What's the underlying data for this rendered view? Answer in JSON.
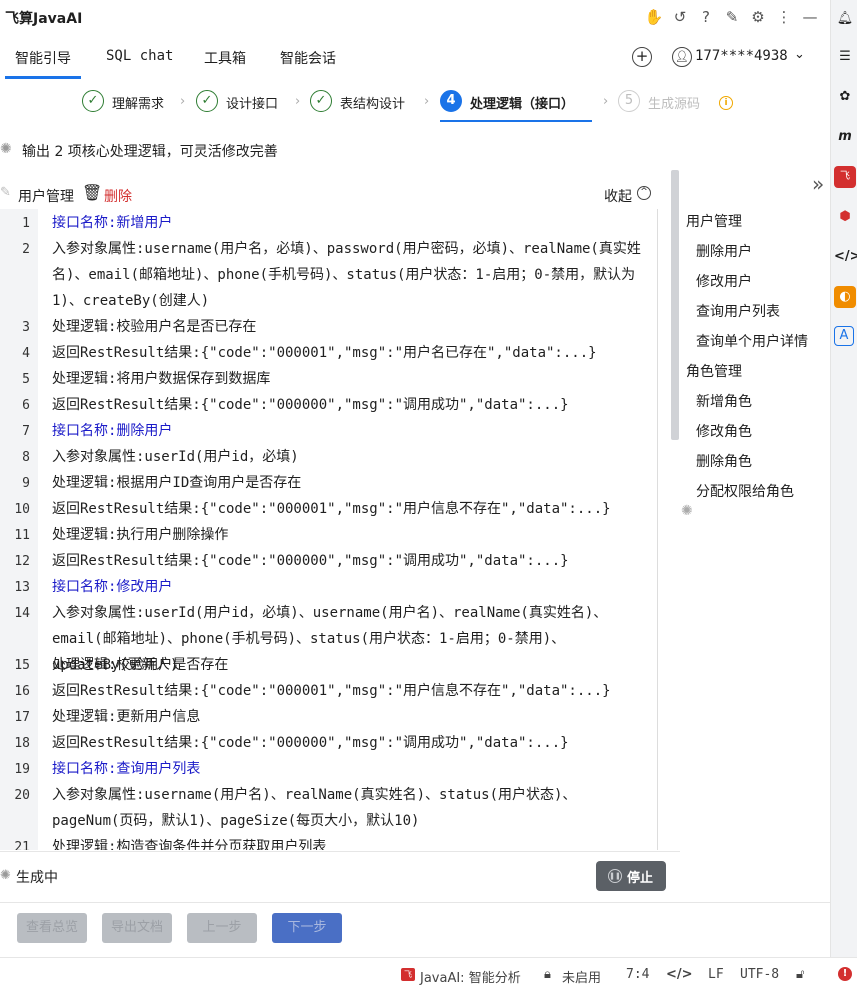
{
  "app": {
    "title": "飞算JavaAI"
  },
  "tabs": [
    "智能引导",
    "SQL chat",
    "工具箱",
    "智能会话"
  ],
  "user": {
    "phone": "177****4938"
  },
  "steps": [
    {
      "label": "理解需求",
      "state": "done"
    },
    {
      "label": "设计接口",
      "state": "done"
    },
    {
      "label": "表结构设计",
      "state": "done"
    },
    {
      "num": "4",
      "label": "处理逻辑（接口）",
      "state": "active"
    },
    {
      "num": "5",
      "label": "生成源码",
      "state": "pending"
    }
  ],
  "summary": "输出 2 项核心处理逻辑，可灵活修改完善",
  "section": {
    "name": "用户管理",
    "delete_label": "删除",
    "collapse_label": "收起"
  },
  "code_lines": [
    {
      "n": "1",
      "text": "接口名称:新增用户",
      "kind": "title"
    },
    {
      "n": "2",
      "text": "入参对象属性:username(用户名，必填)、password(用户密码，必填)、realName(真实姓名)、email(邮箱地址)、phone(手机号码)、status(用户状态：1-启用；0-禁用，默认为1)、createBy(创建人)",
      "kind": "body"
    },
    {
      "n": "3",
      "text": "处理逻辑:校验用户名是否已存在",
      "kind": "body"
    },
    {
      "n": "4",
      "text": "返回RestResult结果:{\"code\":\"000001\",\"msg\":\"用户名已存在\",\"data\":...}",
      "kind": "body"
    },
    {
      "n": "5",
      "text": "处理逻辑:将用户数据保存到数据库",
      "kind": "body"
    },
    {
      "n": "6",
      "text": "返回RestResult结果:{\"code\":\"000000\",\"msg\":\"调用成功\",\"data\":...}",
      "kind": "body"
    },
    {
      "n": "7",
      "text": "接口名称:删除用户",
      "kind": "title"
    },
    {
      "n": "8",
      "text": "入参对象属性:userId(用户id，必填)",
      "kind": "body"
    },
    {
      "n": "9",
      "text": "处理逻辑:根据用户ID查询用户是否存在",
      "kind": "body"
    },
    {
      "n": "10",
      "text": "返回RestResult结果:{\"code\":\"000001\",\"msg\":\"用户信息不存在\",\"data\":...}",
      "kind": "body"
    },
    {
      "n": "11",
      "text": "处理逻辑:执行用户删除操作",
      "kind": "body"
    },
    {
      "n": "12",
      "text": "返回RestResult结果:{\"code\":\"000000\",\"msg\":\"调用成功\",\"data\":...}",
      "kind": "body"
    },
    {
      "n": "13",
      "text": "接口名称:修改用户",
      "kind": "title"
    },
    {
      "n": "14",
      "text": "入参对象属性:userId(用户id，必填)、username(用户名)、realName(真实姓名)、email(邮箱地址)、phone(手机号码)、status(用户状态：1-启用；0-禁用)、updateBy(更新人)",
      "kind": "body"
    },
    {
      "n": "15",
      "text": "处理逻辑:校验用户是否存在",
      "kind": "body"
    },
    {
      "n": "16",
      "text": "返回RestResult结果:{\"code\":\"000001\",\"msg\":\"用户信息不存在\",\"data\":...}",
      "kind": "body"
    },
    {
      "n": "17",
      "text": "处理逻辑:更新用户信息",
      "kind": "body"
    },
    {
      "n": "18",
      "text": "返回RestResult结果:{\"code\":\"000000\",\"msg\":\"调用成功\",\"data\":...}",
      "kind": "body"
    },
    {
      "n": "19",
      "text": "接口名称:查询用户列表",
      "kind": "title"
    },
    {
      "n": "20",
      "text": "入参对象属性:username(用户名)、realName(真实姓名)、status(用户状态)、pageNum(页码，默认1)、pageSize(每页大小，默认10)",
      "kind": "body"
    },
    {
      "n": "21",
      "text": "处理逻辑:构造查询条件并分页获取用户列表",
      "kind": "body"
    }
  ],
  "outline": {
    "groups": [
      {
        "name": "用户管理",
        "items": [
          "删除用户",
          "修改用户",
          "查询用户列表",
          "查询单个用户详情"
        ]
      },
      {
        "name": "角色管理",
        "items": [
          "新增角色",
          "修改角色",
          "删除角色",
          "分配权限给角色"
        ]
      }
    ]
  },
  "status": {
    "generating": "生成中",
    "stop_label": "停止"
  },
  "footer_buttons": [
    "查看总览",
    "导出文档",
    "上一步",
    "下一步"
  ],
  "statusbar": {
    "javaai": "JavaAI: 智能分析",
    "lock_state": "未启用",
    "position": "7:4",
    "line_sep": "LF",
    "encoding": "UTF-8"
  },
  "colors": {
    "accent": "#1a73e8",
    "done": "#2e7d32",
    "link_title": "#1a1ac8",
    "delete": "#d32f2f",
    "next_btn": "#4a6fc5"
  }
}
